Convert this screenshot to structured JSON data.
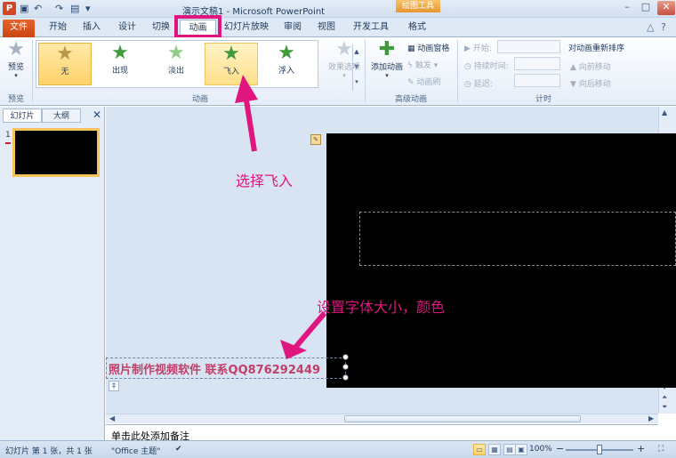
{
  "titlebar": {
    "title": "演示文稿1 - Microsoft PowerPoint",
    "app_icon": "P",
    "context_group": "绘图工具",
    "quick_access": [
      "save-icon",
      "undo-icon",
      "redo-icon",
      "new-slide-icon"
    ],
    "minimize": "–",
    "restore": "□",
    "close": "✕"
  },
  "tabs": [
    {
      "label": "文件"
    },
    {
      "label": "开始"
    },
    {
      "label": "插入"
    },
    {
      "label": "设计"
    },
    {
      "label": "切换"
    },
    {
      "label": "动画"
    },
    {
      "label": "幻灯片放映"
    },
    {
      "label": "审阅"
    },
    {
      "label": "视图"
    },
    {
      "label": "开发工具"
    },
    {
      "label": "格式"
    }
  ],
  "ribbon": {
    "preview": {
      "label": "预览",
      "group": "预览"
    },
    "animation_group": "动画",
    "animations": [
      {
        "label": "无"
      },
      {
        "label": "出现"
      },
      {
        "label": "淡出"
      },
      {
        "label": "飞入"
      },
      {
        "label": "浮入"
      }
    ],
    "effect_options": "效果选项",
    "advanced": {
      "add_animation": "添加动画",
      "animation_pane": "动画窗格",
      "trigger": "触发",
      "animation_painter": "动画刷",
      "group": "高级动画"
    },
    "timing": {
      "start": "开始:",
      "duration": "持续时间:",
      "delay": "延迟:",
      "reorder_title": "对动画重新排序",
      "move_earlier": "向前移动",
      "move_later": "向后移动",
      "group": "计时"
    }
  },
  "left_pane": {
    "tabs": [
      "幻灯片",
      "大纲"
    ],
    "close": "✕",
    "slide_number": "1"
  },
  "slide": {
    "textbox_text": "照片制作视频软件 联系QQ876292449"
  },
  "annotations": {
    "select_fly_in": "选择飞入",
    "set_font": "设置字体大小，颜色"
  },
  "notes": {
    "placeholder": "单击此处添加备注"
  },
  "statusbar": {
    "slide_info": "幻灯片 第 1 张，共 1 张",
    "theme": "\"Office 主题\"",
    "zoom": "100%",
    "zoom_minus": "−",
    "zoom_plus": "+"
  },
  "colors": {
    "annotation": "#e0157f",
    "textbox_text": "#c0406a",
    "file_tab": "#d24726"
  }
}
